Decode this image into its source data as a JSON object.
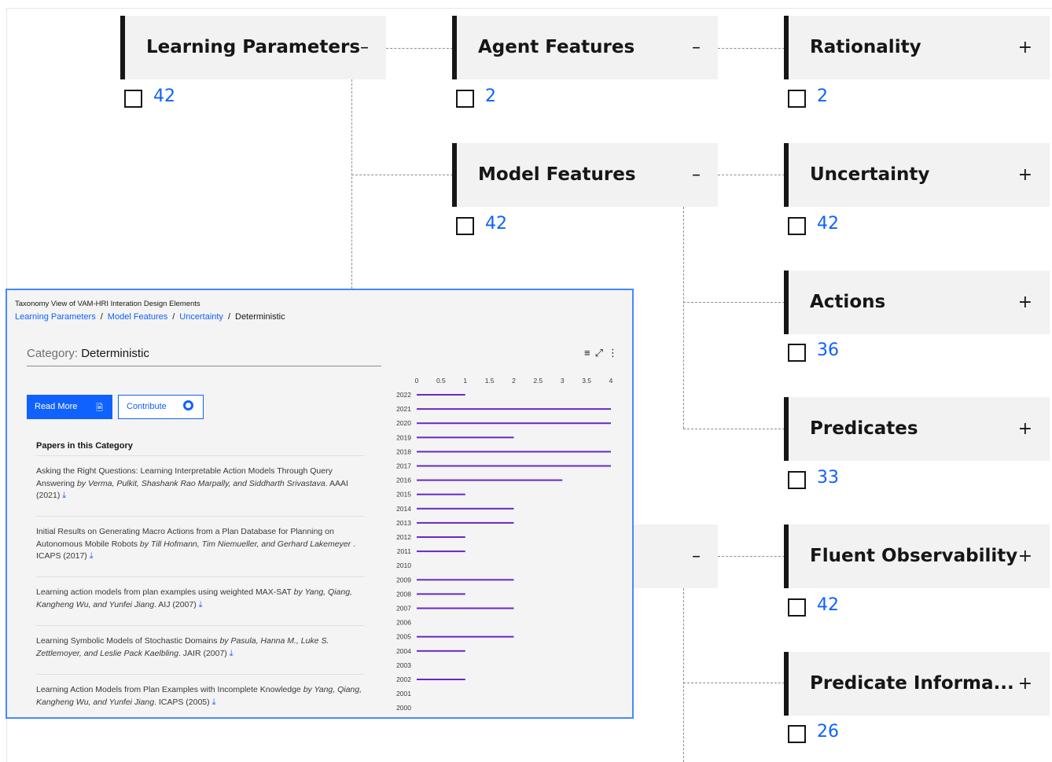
{
  "tree": {
    "nodes": [
      {
        "id": "learning-parameters",
        "title": "Learning Parameters",
        "toggle": "–",
        "count": "42"
      },
      {
        "id": "agent-features",
        "title": "Agent Features",
        "toggle": "–",
        "count": "2"
      },
      {
        "id": "rationality",
        "title": "Rationality",
        "toggle": "+",
        "count": "2"
      },
      {
        "id": "model-features",
        "title": "Model Features",
        "toggle": "–",
        "count": "42"
      },
      {
        "id": "uncertainty",
        "title": "Uncertainty",
        "toggle": "+",
        "count": "42"
      },
      {
        "id": "actions",
        "title": "Actions",
        "toggle": "+",
        "count": "36"
      },
      {
        "id": "predicates",
        "title": "Predicates",
        "toggle": "+",
        "count": "33"
      },
      {
        "id": "hidden-node",
        "title": "",
        "toggle": "–",
        "count": ""
      },
      {
        "id": "fluent-observability",
        "title": "Fluent Observability",
        "toggle": "+",
        "count": "42"
      },
      {
        "id": "predicate-information",
        "title": "Predicate Informa...",
        "toggle": "+",
        "count": "26"
      }
    ]
  },
  "panel": {
    "title": "Taxonomy View of VAM-HRI Interation Design Elements",
    "breadcrumb": [
      "Learning Parameters",
      "Model Features",
      "Uncertainty"
    ],
    "breadcrumb_current": "Deterministic",
    "category_label": "Category:",
    "category_value": "Deterministic",
    "read_more": "Read More",
    "contribute": "Contribute",
    "papers_heading": "Papers in this Category",
    "papers": [
      {
        "title": "Asking the Right Questions: Learning Interpretable Action Models Through Query Answering",
        "authors": "by Verma, Pulkit, Shashank Rao Marpally, and Siddharth Srivastava",
        "venue": ". AAAI (2021)"
      },
      {
        "title": "Initial Results on Generating Macro Actions from a Plan Database for Planning on Autonomous Mobile Robots",
        "authors": "by Till Hofmann, Tim Niemueller, and Gerhard Lakemeyer",
        "venue": " . ICAPS (2017)"
      },
      {
        "title": "Learning action models from plan examples using weighted MAX-SAT",
        "authors": "by Yang, Qiang, Kangheng Wu, and Yunfei Jiang",
        "venue": ". AIJ (2007)"
      },
      {
        "title": "Learning Symbolic Models of Stochastic Domains",
        "authors": "by Pasula, Hanna M., Luke S. Zettlemoyer, and Leslie Pack Kaelbling",
        "venue": ". JAIR (2007)"
      },
      {
        "title": "Learning Action Models from Plan Examples with Incomplete Knowledge",
        "authors": "by Yang, Qiang, Kangheng Wu, and Yunfei Jiang",
        "venue": ". ICAPS (2005)"
      }
    ],
    "chart_data": {
      "type": "bar",
      "orientation": "horizontal",
      "categories": [
        "2022",
        "2021",
        "2020",
        "2019",
        "2018",
        "2017",
        "2016",
        "2015",
        "2014",
        "2013",
        "2012",
        "2011",
        "2010",
        "2009",
        "2008",
        "2007",
        "2006",
        "2005",
        "2004",
        "2003",
        "2002",
        "2001",
        "2000"
      ],
      "values": [
        1,
        4,
        4,
        2,
        4,
        4,
        3,
        1,
        2,
        2,
        1,
        1,
        0,
        2,
        1,
        2,
        0,
        2,
        1,
        0,
        1,
        0,
        0
      ],
      "xticks": [
        "0",
        "0.5",
        "1",
        "1.5",
        "2",
        "2.5",
        "3",
        "3.5",
        "4"
      ],
      "xlim": [
        0,
        4
      ],
      "color": "#6929c4",
      "grid": false
    }
  }
}
